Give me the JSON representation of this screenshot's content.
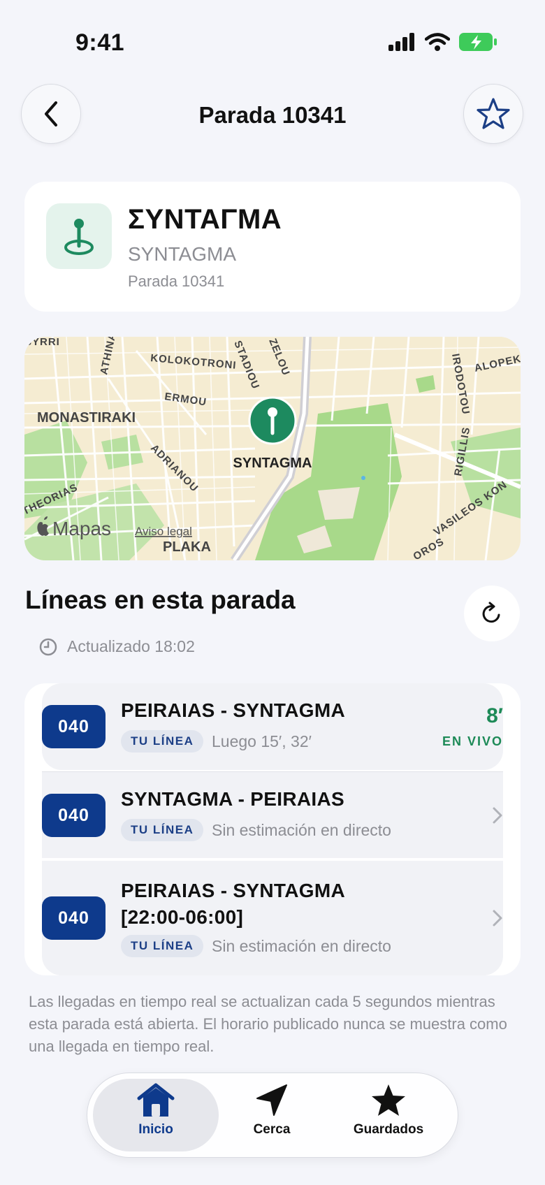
{
  "status_bar": {
    "time": "9:41"
  },
  "nav": {
    "title": "Parada 10341"
  },
  "stop": {
    "name_greek": "ΣΥΝΤΑΓΜΑ",
    "name_latin": "SYNTAGMA",
    "code_label": "Parada 10341"
  },
  "map": {
    "pin_label": "SYNTAGMA",
    "streets": [
      "KOLOKOTRONI",
      "STADIOU",
      "ZELOU",
      "ERMOU",
      "ADRIANOU",
      "IRODOTOU",
      "ALOPEKI",
      "RIGILLIS",
      "ATHINA",
      "SYRRI",
      "THEORIAS",
      "VASILEOS KON",
      "OROS"
    ],
    "areas": [
      "MONASTIRAKI",
      "PLAKA"
    ],
    "brand": "Mapas",
    "legal": "Aviso legal"
  },
  "lines_section": {
    "title": "Líneas en esta parada",
    "updated": "Actualizado 18:02",
    "items": [
      {
        "badge": "040",
        "route": "PEIRAIAS - SYNTAGMA",
        "tag": "TU LÍNEA",
        "detail": "Luego 15′, 32′",
        "eta": "8′",
        "live": "EN VIVO"
      },
      {
        "badge": "040",
        "route": "SYNTAGMA - PEIRAIAS",
        "tag": "TU LÍNEA",
        "detail": "Sin estimación en directo"
      },
      {
        "badge": "040",
        "route_line1": "PEIRAIAS - SYNTAGMA",
        "route_line2": "[22:00-06:00]",
        "tag": "TU LÍNEA",
        "detail": "Sin estimación en directo"
      }
    ]
  },
  "footnote": "Las llegadas en tiempo real se actualizan cada 5 segundos mientras esta parada está abierta. El horario publicado nunca se muestra como una llegada en tiempo real.",
  "tabbar": {
    "tabs": [
      {
        "label": "Inicio",
        "icon": "home-icon",
        "active": true
      },
      {
        "label": "Cerca",
        "icon": "location-arrow-icon"
      },
      {
        "label": "Guardados",
        "icon": "star-filled-icon"
      }
    ]
  },
  "colors": {
    "brand_blue": "#0e3a8c",
    "live_green": "#1d8a57",
    "pin_green": "#1d8a5f"
  }
}
